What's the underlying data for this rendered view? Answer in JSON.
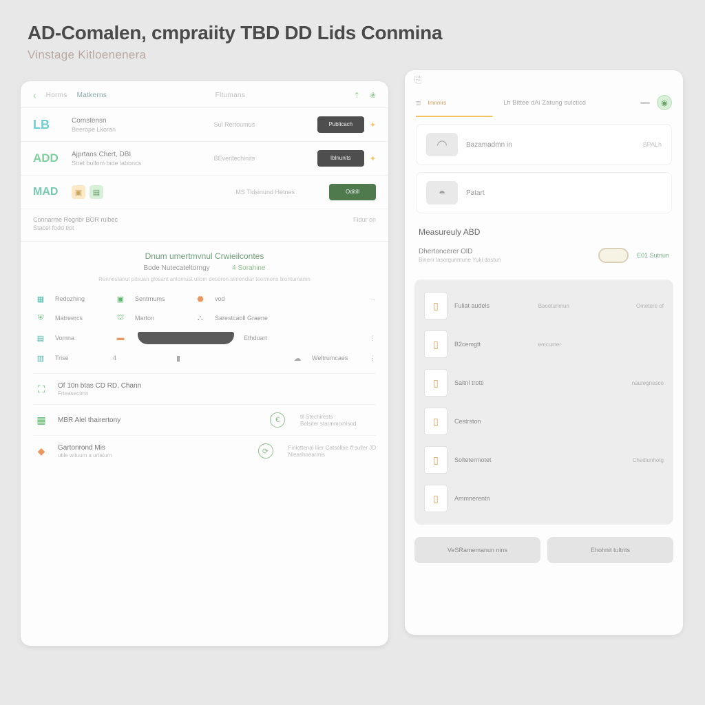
{
  "header": {
    "title": "AD-Comalen, cmpraiity TBD DD Lids Conmina",
    "subtitle": "Vinstage Kitloenenera"
  },
  "left": {
    "tabs": {
      "back": "‹",
      "t1": "Horms",
      "t2": "Matkerns",
      "t3": "Fltumans"
    },
    "rows": [
      {
        "logo": "LB",
        "cls": "lb",
        "t1": "Comstensn",
        "t2": "Beerope Lkoran",
        "mid": "Sul Rertoumus",
        "btn": "Publicach",
        "bcls": "dark"
      },
      {
        "logo": "ADD",
        "cls": "add",
        "t1": "Ajprtans Chert, DBI",
        "t2": "Stret bullom bide laboncs",
        "mid": "BEveritechinits",
        "btn": "Iblnunits",
        "bcls": "dark"
      },
      {
        "logo": "MAD",
        "cls": "mad",
        "t1": "",
        "t2": "",
        "mid": "MS Tidsinund Hetnes",
        "btn": "Oditill",
        "bcls": "green"
      }
    ],
    "foot": {
      "l1": "Connarme Rogribr BOR rulbec",
      "l2": "Stacel fodd tiot",
      "r": "Fidur on"
    },
    "section": {
      "hd": "Dnum umertmvnul Crwieilcontes",
      "sub1": "Bode Nutecateltorngy",
      "sub2": "4 Sorahine",
      "desc": "Rennestanut pitsuan glosant antomust uliom desoron simendiar teermens biontumamn"
    },
    "tags": {
      "r1": [
        {
          "ic": "▦",
          "ccls": "teal",
          "lbl": "Redozhing"
        },
        {
          "ic": "▣",
          "ccls": "green",
          "lbl": "Sentrnums"
        },
        {
          "ic": "",
          "ccls": "grey",
          "lbl": "vod"
        }
      ],
      "r2": [
        {
          "ic": "⛨",
          "ccls": "green",
          "lbl": "Matreercs"
        },
        {
          "ic": "⛫",
          "ccls": "green",
          "lbl": "Marton"
        },
        {
          "ic": "⛬",
          "ccls": "grey",
          "lbl": "Sarestcaoll Graene"
        }
      ],
      "r3a": {
        "ic": "▤",
        "ccls": "teal",
        "lbl": "Vomna"
      },
      "r3b": "Ethduart",
      "r4": [
        {
          "ic": "▥",
          "ccls": "teal",
          "lbl": "Trise"
        },
        {
          "ic": "▮",
          "ccls": "grey",
          "lbl": ""
        },
        {
          "ic": "",
          "ccls": "grey",
          "lbl": "Weltrumcaes"
        }
      ]
    },
    "list": [
      {
        "ic": "⛶",
        "ccls": "g",
        "t": "Of 10n btas CD RD, Chann",
        "s": "Frteasectmn",
        "cic": "",
        "m1": "",
        "m2": ""
      },
      {
        "ic": "▦",
        "ccls": "g",
        "t": "MBR Alel thairertony",
        "s": "",
        "cic": "€",
        "m1": "til Stechirests",
        "m2": "Bolsiter starmmomisod"
      },
      {
        "ic": "◆",
        "ccls": "o",
        "t": "Gartonrond Mis",
        "s": "utile wituum a urtatum",
        "cic": "⟳",
        "m1": "Finlottenal Ilier Catsolbie ff suller JD",
        "m2": "Nieashnearmis"
      }
    ]
  },
  "right": {
    "top": {
      "tab0": "Imnmrs",
      "ttl": "Lh Bittee dAi Zatung sulcticd"
    },
    "cards": [
      {
        "glyph": "◠",
        "lbl": "Bazamadmn in",
        "val": "SPALh"
      },
      {
        "glyph": "◓",
        "lbl": "Patart",
        "val": ""
      }
    ],
    "sec": "Measureuly ABD",
    "feat": {
      "t": "Dhertoncerer OlD",
      "s": "Binerir lasorgunmune Yuki dastun",
      "badge": "E01 Sutnun"
    },
    "grid": [
      {
        "glyph": "▯",
        "lbl": "Fuliat audels",
        "c2": "Baoetunmun",
        "c3": "Ometere of"
      },
      {
        "glyph": "▯",
        "lbl": "B2cemgtt",
        "c2": "emcumer",
        "c3": ""
      },
      {
        "glyph": "▯",
        "lbl": "Saitnl trotti",
        "c2": "",
        "c3": "nauregnesco"
      },
      {
        "glyph": "▯",
        "lbl": "Cestrston",
        "c2": "",
        "c3": ""
      },
      {
        "glyph": "▯",
        "lbl": "Soltetermotet",
        "c2": "",
        "c3": "Chediunhotg"
      },
      {
        "glyph": "▯",
        "lbl": "Ammnerentn",
        "c2": "",
        "c3": ""
      }
    ],
    "btns": {
      "b1": "VeSRamemanun nins",
      "b2": "Ehohnit tultrits"
    }
  }
}
